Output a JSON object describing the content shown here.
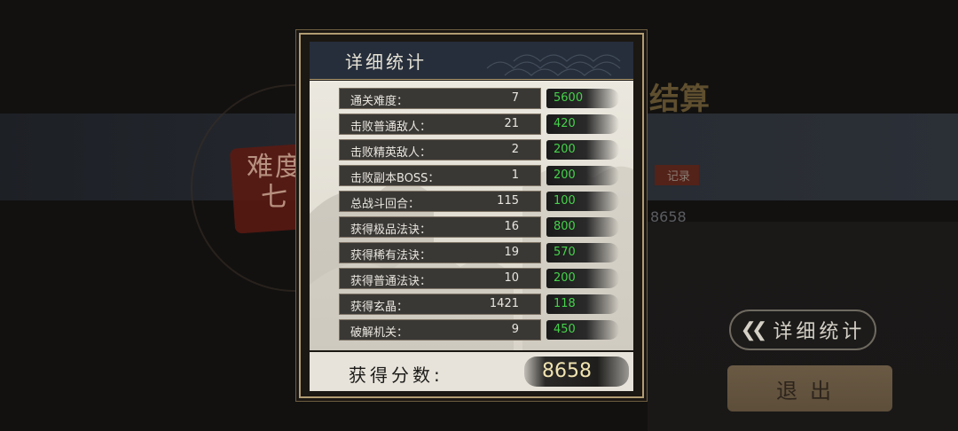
{
  "background": {
    "difficulty_text": "难度七",
    "title_partial": "结算",
    "record_tag": "记录",
    "score_partial": "8658"
  },
  "modal": {
    "title": "详细统计",
    "rows": [
      {
        "label": "通关难度：",
        "count": "7",
        "score": "5600"
      },
      {
        "label": "击败普通敌人：",
        "count": "21",
        "score": "420"
      },
      {
        "label": "击败精英敌人：",
        "count": "2",
        "score": "200"
      },
      {
        "label": "击败副本BOSS：",
        "count": "1",
        "score": "200"
      },
      {
        "label": "总战斗回合：",
        "count": "115",
        "score": "100"
      },
      {
        "label": "获得极品法诀：",
        "count": "16",
        "score": "800"
      },
      {
        "label": "获得稀有法诀：",
        "count": "19",
        "score": "570"
      },
      {
        "label": "获得普通法诀：",
        "count": "10",
        "score": "200"
      },
      {
        "label": "获得玄晶：",
        "count": "1421",
        "score": "118"
      },
      {
        "label": "破解机关：",
        "count": "9",
        "score": "450"
      }
    ],
    "total_label": "获得分数:",
    "total_value": "8658"
  },
  "buttons": {
    "detail_stats": "详细统计",
    "exit": "退出"
  },
  "icons": {
    "detail_stats_icon": "double-chevron-left-icon"
  },
  "colors": {
    "score_green": "#44d24a",
    "frame_gold": "#b29c72",
    "header_navy": "#262e3b"
  }
}
